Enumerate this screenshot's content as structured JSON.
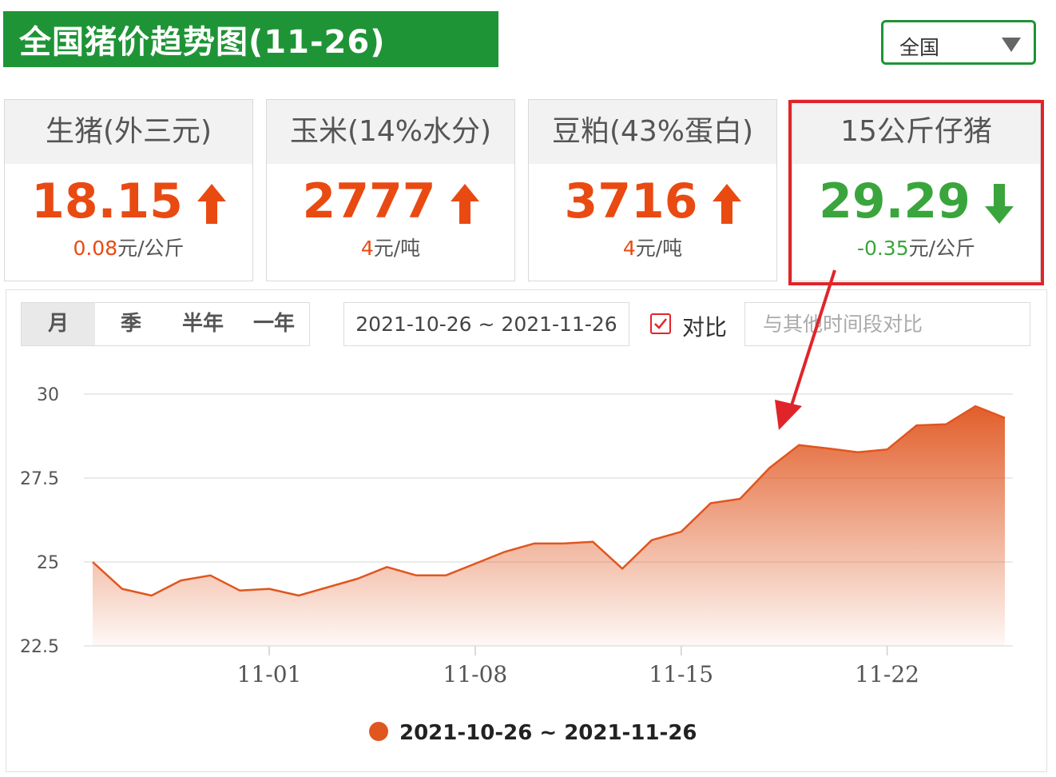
{
  "header": {
    "title": "全国猪价趋势图(11-26)",
    "region_select_value": "全国"
  },
  "cards": [
    {
      "name": "生猪(外三元)",
      "value": "18.15",
      "trend": "up",
      "change_num": "0.08",
      "change_unit": "元/公斤"
    },
    {
      "name": "玉米(14%水分)",
      "value": "2777",
      "trend": "up",
      "change_num": "4",
      "change_unit": "元/吨"
    },
    {
      "name": "豆粕(43%蛋白)",
      "value": "3716",
      "trend": "up",
      "change_num": "4",
      "change_unit": "元/吨"
    },
    {
      "name": "15公斤仔猪",
      "value": "29.29",
      "trend": "down",
      "change_num": "-0.35",
      "change_unit": "元/公斤"
    }
  ],
  "colors": {
    "up": "#e94a12",
    "down": "#3aa53c",
    "brand": "#1e9436",
    "highlight": "#e0252a",
    "series": "#e0561f"
  },
  "controls": {
    "tabs": [
      "月",
      "季",
      "半年",
      "一年"
    ],
    "active_tab": "月",
    "date_range": "2021-10-26 ~ 2021-11-26",
    "compare_label": "对比",
    "compare_checked": true,
    "compare_placeholder": "与其他时间段对比"
  },
  "chart_data": {
    "type": "area",
    "x": [
      "10-26",
      "10-27",
      "10-28",
      "10-29",
      "10-30",
      "10-31",
      "11-01",
      "11-02",
      "11-03",
      "11-04",
      "11-05",
      "11-06",
      "11-07",
      "11-08",
      "11-09",
      "11-10",
      "11-11",
      "11-12",
      "11-13",
      "11-14",
      "11-15",
      "11-16",
      "11-17",
      "11-18",
      "11-19",
      "11-20",
      "11-21",
      "11-22",
      "11-23",
      "11-24",
      "11-25",
      "11-26"
    ],
    "x_ticks": [
      "11-01",
      "11-08",
      "11-15",
      "11-22"
    ],
    "y_ticks": [
      "22.5",
      "25",
      "27.5",
      "30"
    ],
    "ylim": [
      22.5,
      30
    ],
    "grid": true,
    "series": [
      {
        "name": "2021-10-26 ~ 2021-11-26",
        "values": [
          25.0,
          24.2,
          24.0,
          24.45,
          24.6,
          24.15,
          24.2,
          24.0,
          24.25,
          24.5,
          24.85,
          24.6,
          24.6,
          24.95,
          25.3,
          25.55,
          25.55,
          25.6,
          24.8,
          25.65,
          25.9,
          26.75,
          26.88,
          27.8,
          28.48,
          28.38,
          28.27,
          28.35,
          29.07,
          29.1,
          29.64,
          29.29
        ]
      }
    ],
    "legend_position": "bottom-center"
  }
}
